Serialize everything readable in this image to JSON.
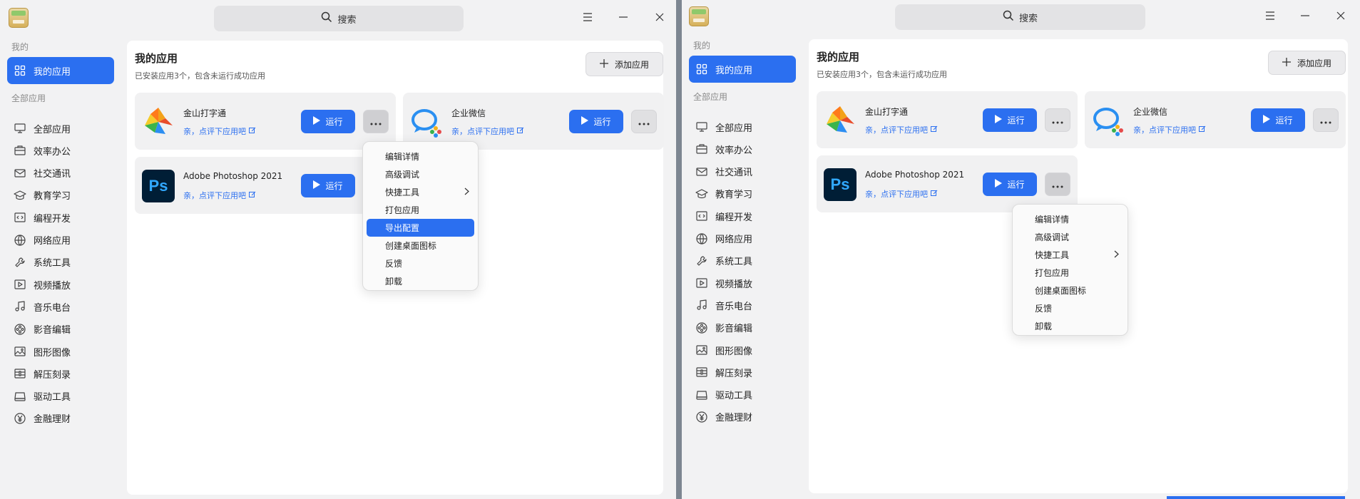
{
  "left": {
    "search": {
      "label": "搜索"
    },
    "sidebar": {
      "group_mine": "我的",
      "my_apps": "我的应用",
      "group_all": "全部应用",
      "items": [
        {
          "label": "全部应用",
          "icon": "monitor-icon"
        },
        {
          "label": "效率办公",
          "icon": "briefcase-icon"
        },
        {
          "label": "社交通讯",
          "icon": "mail-icon"
        },
        {
          "label": "教育学习",
          "icon": "graduation-cap-icon"
        },
        {
          "label": "编程开发",
          "icon": "code-icon"
        },
        {
          "label": "网络应用",
          "icon": "globe-icon"
        },
        {
          "label": "系统工具",
          "icon": "wrench-icon"
        },
        {
          "label": "视频播放",
          "icon": "video-play-icon"
        },
        {
          "label": "音乐电台",
          "icon": "music-note-icon"
        },
        {
          "label": "影音编辑",
          "icon": "film-reel-icon"
        },
        {
          "label": "图形图像",
          "icon": "image-icon"
        },
        {
          "label": "解压刻录",
          "icon": "archive-icon"
        },
        {
          "label": "驱动工具",
          "icon": "drive-icon"
        },
        {
          "label": "金融理财",
          "icon": "yuan-icon"
        }
      ]
    },
    "main": {
      "title": "我的应用",
      "subtitle": "已安装应用3个，包含未运行成功应用",
      "add_label": "添加应用",
      "apps": [
        {
          "name": "金山打字通",
          "rate": "亲，点评下应用吧",
          "run": "运行",
          "icon": "kingsoft-typing-icon"
        },
        {
          "name": "企业微信",
          "rate": "亲，点评下应用吧",
          "run": "运行",
          "icon": "wecom-icon"
        },
        {
          "name": "Adobe Photoshop 2021",
          "rate": "亲，点评下应用吧",
          "run": "运行",
          "icon": "photoshop-icon",
          "icon_text": "Ps"
        }
      ]
    },
    "context_menu": {
      "items": [
        "编辑详情",
        "高级调试",
        "快捷工具",
        "打包应用",
        "导出配置",
        "创建桌面图标",
        "反馈",
        "卸载"
      ],
      "highlighted": "导出配置"
    }
  },
  "right": {
    "search": {
      "label": "搜索"
    },
    "sidebar": {
      "group_mine": "我的",
      "my_apps": "我的应用",
      "group_all": "全部应用",
      "items": [
        {
          "label": "全部应用"
        },
        {
          "label": "效率办公"
        },
        {
          "label": "社交通讯"
        },
        {
          "label": "教育学习"
        },
        {
          "label": "编程开发"
        },
        {
          "label": "网络应用"
        },
        {
          "label": "系统工具"
        },
        {
          "label": "视频播放"
        },
        {
          "label": "音乐电台"
        },
        {
          "label": "影音编辑"
        },
        {
          "label": "图形图像"
        },
        {
          "label": "解压刻录"
        },
        {
          "label": "驱动工具"
        },
        {
          "label": "金融理财"
        }
      ]
    },
    "main": {
      "title": "我的应用",
      "subtitle": "已安装应用3个，包含未运行成功应用",
      "add_label": "添加应用",
      "apps": [
        {
          "name": "金山打字通",
          "rate": "亲，点评下应用吧",
          "run": "运行"
        },
        {
          "name": "企业微信",
          "rate": "亲，点评下应用吧",
          "run": "运行"
        },
        {
          "name": "Adobe Photoshop 2021",
          "rate": "亲，点评下应用吧",
          "run": "运行",
          "icon_text": "Ps"
        }
      ]
    },
    "context_menu": {
      "items": [
        "编辑详情",
        "高级调试",
        "快捷工具",
        "打包应用",
        "创建桌面图标",
        "反馈",
        "卸载"
      ]
    }
  },
  "colors": {
    "accent": "#2b6ff0",
    "card_bg": "#f1f1f2",
    "window_bg": "#f2f2f3"
  }
}
